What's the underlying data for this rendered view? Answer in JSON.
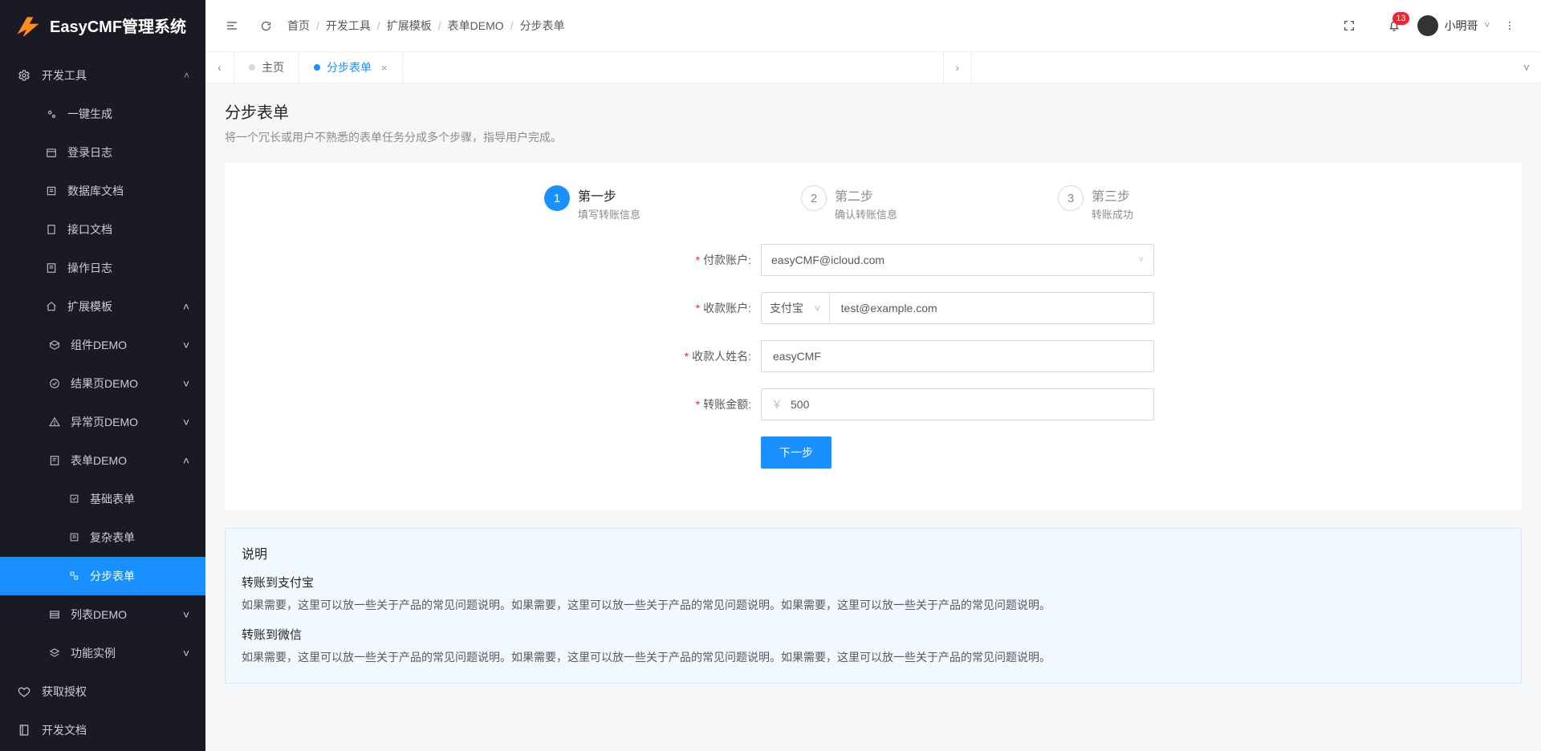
{
  "app_name": "EasyCMF管理系统",
  "topbar": {
    "breadcrumbs": [
      "首页",
      "开发工具",
      "扩展模板",
      "表单DEMO",
      "分步表单"
    ],
    "notification_count": "13",
    "username": "小明哥"
  },
  "tabs": {
    "items": [
      {
        "label": "主页",
        "closable": false,
        "active": false
      },
      {
        "label": "分步表单",
        "closable": true,
        "active": true
      }
    ]
  },
  "sidebar": {
    "dev_tools": {
      "label": "开发工具"
    },
    "dev_children": {
      "onekey": {
        "label": "一键生成"
      },
      "loginlog": {
        "label": "登录日志"
      },
      "dbdoc": {
        "label": "数据库文档"
      },
      "apidoc": {
        "label": "接口文档"
      },
      "oplog": {
        "label": "操作日志"
      }
    },
    "ext_tpl": {
      "label": "扩展模板"
    },
    "ext_children": {
      "comp": {
        "label": "组件DEMO"
      },
      "result": {
        "label": "结果页DEMO"
      },
      "error": {
        "label": "异常页DEMO"
      },
      "form": {
        "label": "表单DEMO"
      },
      "list": {
        "label": "列表DEMO"
      },
      "func": {
        "label": "功能实例"
      }
    },
    "form_children": {
      "basic": {
        "label": "基础表单"
      },
      "complex": {
        "label": "复杂表单"
      },
      "step": {
        "label": "分步表单"
      }
    },
    "license": {
      "label": "获取授权"
    },
    "devdoc": {
      "label": "开发文档"
    }
  },
  "page": {
    "title": "分步表单",
    "desc": "将一个冗长或用户不熟悉的表单任务分成多个步骤，指导用户完成。"
  },
  "steps": [
    {
      "num": "1",
      "title": "第一步",
      "desc": "填写转账信息"
    },
    {
      "num": "2",
      "title": "第二步",
      "desc": "确认转账信息"
    },
    {
      "num": "3",
      "title": "第三步",
      "desc": "转账成功"
    }
  ],
  "form": {
    "pay_account": {
      "label": "付款账户:",
      "value": "easyCMF@icloud.com"
    },
    "recv_account": {
      "label": "收款账户:",
      "method": "支付宝",
      "value": "test@example.com"
    },
    "recv_name": {
      "label": "收款人姓名:",
      "value": "easyCMF"
    },
    "amount": {
      "label": "转账金额:",
      "prefix": "￥",
      "value": "500"
    },
    "next_btn": "下一步"
  },
  "info": {
    "title": "说明",
    "s1_title": "转账到支付宝",
    "s1_body": "如果需要，这里可以放一些关于产品的常见问题说明。如果需要，这里可以放一些关于产品的常见问题说明。如果需要，这里可以放一些关于产品的常见问题说明。",
    "s2_title": "转账到微信",
    "s2_body": "如果需要，这里可以放一些关于产品的常见问题说明。如果需要，这里可以放一些关于产品的常见问题说明。如果需要，这里可以放一些关于产品的常见问题说明。"
  }
}
